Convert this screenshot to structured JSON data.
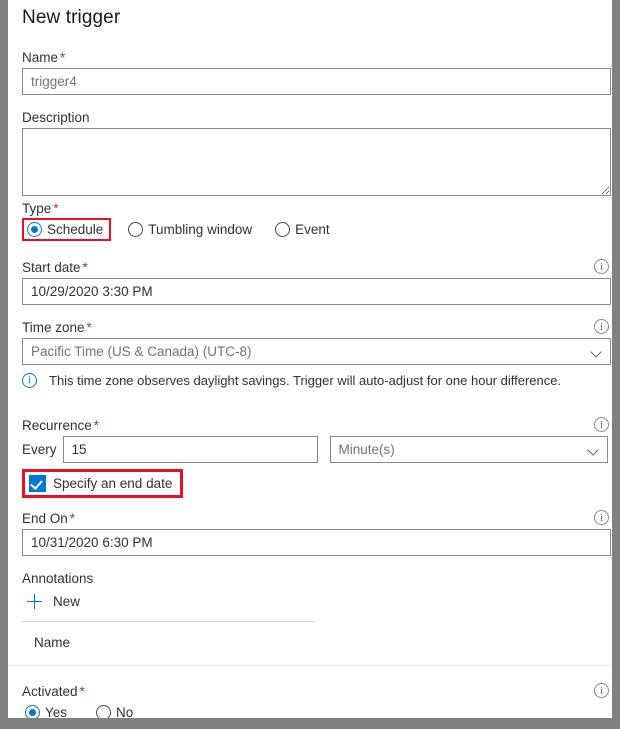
{
  "dialog": {
    "title": "New trigger"
  },
  "fields": {
    "name": {
      "label": "Name",
      "required": "*",
      "value": "trigger4"
    },
    "description": {
      "label": "Description",
      "value": ""
    },
    "type": {
      "label": "Type",
      "required": "*",
      "options": [
        {
          "label": "Schedule",
          "selected": true,
          "highlighted": true
        },
        {
          "label": "Tumbling window",
          "selected": false,
          "highlighted": false
        },
        {
          "label": "Event",
          "selected": false,
          "highlighted": false
        }
      ]
    },
    "start_date": {
      "label": "Start date",
      "required": "*",
      "value": "10/29/2020 3:30 PM",
      "info_icon": "info-icon"
    },
    "time_zone": {
      "label": "Time zone",
      "required": "*",
      "value": "Pacific Time (US & Canada) (UTC-8)",
      "info_icon": "info-icon",
      "chevron": "chevron-down-icon"
    },
    "daylight_notice": {
      "icon": "info-circle-icon",
      "text": "This time zone observes daylight savings. Trigger will auto-adjust for one hour difference."
    },
    "recurrence": {
      "label": "Recurrence",
      "required": "*",
      "every_label": "Every",
      "interval_value": "15",
      "unit_value": "Minute(s)",
      "info_icon": "info-icon"
    },
    "specify_end_date": {
      "label": "Specify an end date",
      "checked": true,
      "highlighted": true
    },
    "end_on": {
      "label": "End On",
      "required": "*",
      "value": "10/31/2020 6:30 PM",
      "info_icon": "info-icon"
    },
    "annotations": {
      "label": "Annotations",
      "new_label": "New",
      "new_icon": "plus-icon",
      "columns": [
        "Name"
      ],
      "rows": []
    },
    "activated": {
      "label": "Activated",
      "required": "*",
      "info_icon": "info-icon",
      "options": [
        {
          "label": "Yes",
          "selected": true
        },
        {
          "label": "No",
          "selected": false
        }
      ]
    }
  },
  "colors": {
    "accent": "#0078d4",
    "highlight": "#e81123",
    "required": "#a4373a",
    "frame": "#808080"
  }
}
